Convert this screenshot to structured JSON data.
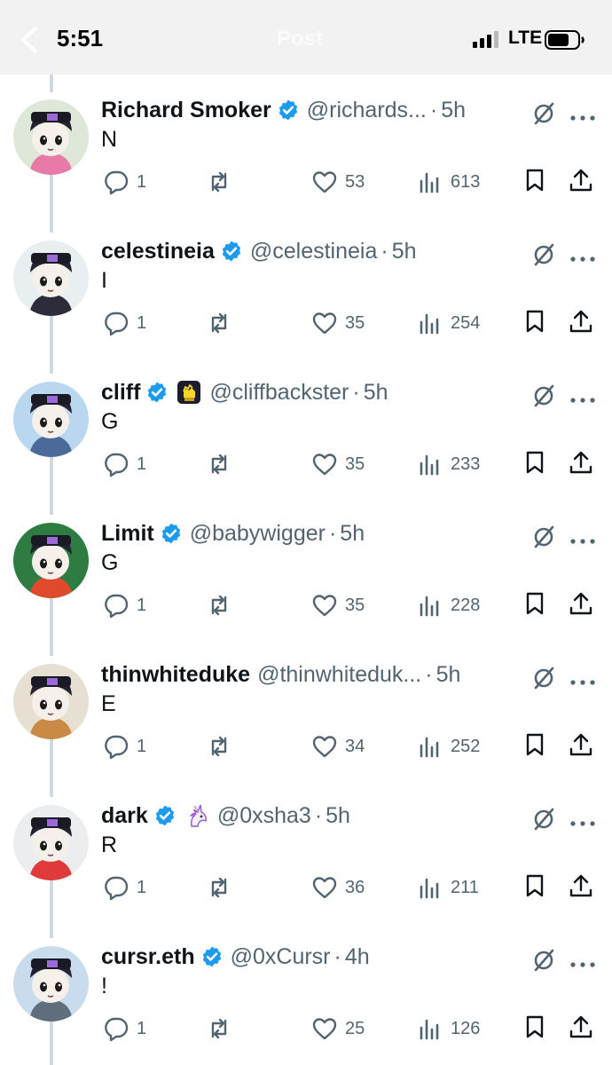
{
  "status_bar": {
    "time": "5:51",
    "network": "LTE",
    "nav_title": "Post"
  },
  "tweets": [
    {
      "name": "Richard Smoker",
      "verified": true,
      "handle": "@richards...",
      "time": "5h",
      "text": "N",
      "replies": "1",
      "likes": "53",
      "views": "613",
      "avatar_bg": "#dfe8d8",
      "avatar_color": "#e87aa8"
    },
    {
      "name": "celestineia",
      "verified": true,
      "handle": "@celestineia",
      "time": "5h",
      "text": "I",
      "replies": "1",
      "likes": "35",
      "views": "254",
      "avatar_bg": "#e9eef0",
      "avatar_color": "#2c2c3a"
    },
    {
      "name": "cliff",
      "verified": true,
      "emoji_icon": "fist-badge-icon",
      "handle": "@cliffbackster",
      "time": "5h",
      "text": "G",
      "replies": "1",
      "likes": "35",
      "views": "233",
      "avatar_bg": "#b9d8ef",
      "avatar_color": "#4b6a9a"
    },
    {
      "name": "Limit",
      "verified": true,
      "handle": "@babywigger",
      "time": "5h",
      "text": "G",
      "replies": "1",
      "likes": "35",
      "views": "228",
      "avatar_bg": "#2f7c43",
      "avatar_color": "#e04a2c"
    },
    {
      "name": "thinwhiteduke",
      "verified": false,
      "handle": "@thinwhiteduk...",
      "time": "5h",
      "text": "E",
      "replies": "1",
      "likes": "34",
      "views": "252",
      "avatar_bg": "#e6dfd2",
      "avatar_color": "#c98a45"
    },
    {
      "name": "dark",
      "verified": true,
      "emoji_icon": "unicorn-icon",
      "handle": "@0xsha3",
      "time": "5h",
      "text": "R",
      "replies": "1",
      "likes": "36",
      "views": "211",
      "avatar_bg": "#ecedee",
      "avatar_color": "#e03a3a"
    },
    {
      "name": "cursr.eth",
      "verified": true,
      "handle": "@0xCursr",
      "time": "4h",
      "text": "!",
      "replies": "1",
      "likes": "25",
      "views": "126",
      "avatar_bg": "#c9dced",
      "avatar_color": "#5f6d7c"
    }
  ],
  "colors": {
    "verified": "#1d9bf0",
    "muted": "#536471",
    "text": "#0f1419",
    "line": "#cfd9de"
  }
}
